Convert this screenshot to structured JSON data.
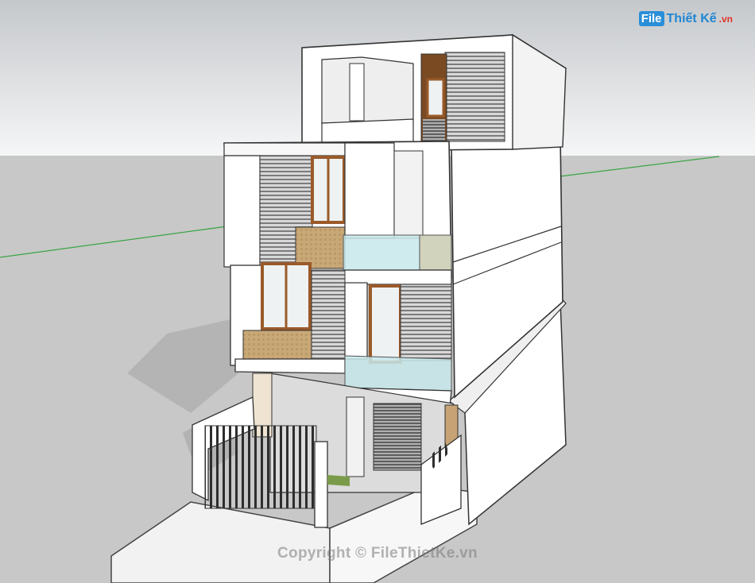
{
  "watermark_logo": {
    "badge": "File",
    "text": "Thiết Kế",
    "suffix": ".vn"
  },
  "copyright_text": "Copyright © FileThietKe.vn",
  "colors": {
    "sky_top": "#c9cccf",
    "sky_bottom": "#f4f5f6",
    "ground": "#c9c9c9",
    "wall": "#ffffff",
    "wall_shade": "#e6e6e6",
    "louver": "#8b8b8b",
    "wood_frame": "#9a5a2a",
    "planter": "#c8a878",
    "glass": "#bfe3e6",
    "axis_green": "#3aa544"
  }
}
